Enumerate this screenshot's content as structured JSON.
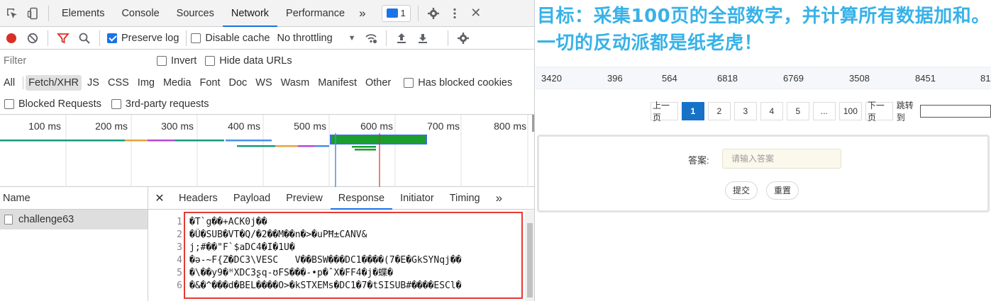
{
  "devtools": {
    "tabs": [
      "Elements",
      "Console",
      "Sources",
      "Network",
      "Performance"
    ],
    "active_tab": "Network",
    "more_tabs": "»",
    "issues_count": "1",
    "close": "✕",
    "toolbar": {
      "preserve_log": "Preserve log",
      "disable_cache": "Disable cache",
      "throttling": "No throttling",
      "dropdown_arrow": "▼"
    },
    "filter": {
      "placeholder": "Filter",
      "invert": "Invert",
      "hide_data_urls": "Hide data URLs"
    },
    "types": [
      "All",
      "Fetch/XHR",
      "JS",
      "CSS",
      "Img",
      "Media",
      "Font",
      "Doc",
      "WS",
      "Wasm",
      "Manifest",
      "Other"
    ],
    "active_type": "Fetch/XHR",
    "has_blocked_cookies": "Has blocked cookies",
    "blocked_requests": "Blocked Requests",
    "third_party": "3rd-party requests",
    "timeline": {
      "ticks": [
        "100 ms",
        "200 ms",
        "300 ms",
        "400 ms",
        "500 ms",
        "600 ms",
        "700 ms",
        "800 ms"
      ]
    },
    "name_header": "Name",
    "request_name": "challenge63",
    "detail_tabs": [
      "Headers",
      "Payload",
      "Preview",
      "Response",
      "Initiator",
      "Timing"
    ],
    "active_detail_tab": "Response",
    "response_lines": [
      {
        "n": "1",
        "text": "�T`g��+ACK0j��"
      },
      {
        "n": "2",
        "text": "�Û�SUB�VT�Q/�2��M��n�>�uPĦ±CANV&"
      },
      {
        "n": "3",
        "text": "j;#��\"F`$aDC4�I�1U�"
      },
      {
        "n": "4",
        "text": "�ə-~F{Z�DC3\\VESC   V��BSW���DC1����(7�E�GkSYNqj��"
      },
      {
        "n": "5",
        "text": "�\\��y9�ᴴXDC3ʂq-ʊFS���-•p�ˆX�FF4�j�蝶�"
      },
      {
        "n": "6",
        "text": "�&�^���d�BEL����O>�kSTXEMs�DC1�7�tSISUB#����ESCl�"
      }
    ]
  },
  "page": {
    "headline": "目标：采集100页的全部数字，并计算所有数据加和。一切的反动派都是纸老虎！",
    "numbers": [
      "3420",
      "396",
      "564",
      "6818",
      "6769",
      "3508",
      "8451",
      "81"
    ],
    "pager": {
      "prev": "上一页",
      "pages": [
        "1",
        "2",
        "3",
        "4",
        "5"
      ],
      "ellipsis": "...",
      "last": "100",
      "next": "下一页",
      "jump": "跳转到",
      "current": "1"
    },
    "answer_label": "答案:",
    "answer_placeholder": "请输入答案",
    "submit": "提交",
    "reset": "重置"
  },
  "colors": {
    "accent": "#1a73e8",
    "record": "#d93025",
    "headline": "#38b2e8",
    "pager_active": "#1772c7",
    "highlight_box": "#e53935"
  }
}
